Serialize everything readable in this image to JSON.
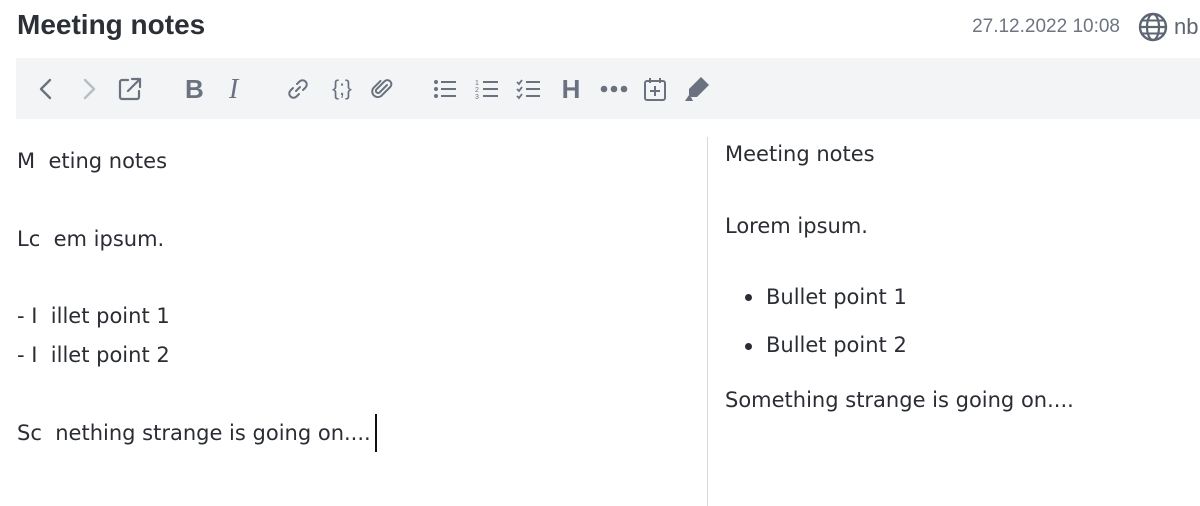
{
  "header": {
    "title": "Meeting notes",
    "datetime": "27.12.2022 10:08",
    "language": "nb"
  },
  "toolbar": {
    "heading_label": "H",
    "code_label": "{;}"
  },
  "editor": {
    "lines": [
      "M  eting notes",
      "Lc  em ipsum.",
      "- I  illet point 1",
      "- I  illet point 2",
      "Sc  nething strange is going on...."
    ]
  },
  "preview": {
    "heading": "Meeting notes",
    "paragraph": "Lorem ipsum.",
    "bullets": [
      "Bullet point 1",
      "Bullet point 2"
    ],
    "closing": "Something strange is going on...."
  }
}
